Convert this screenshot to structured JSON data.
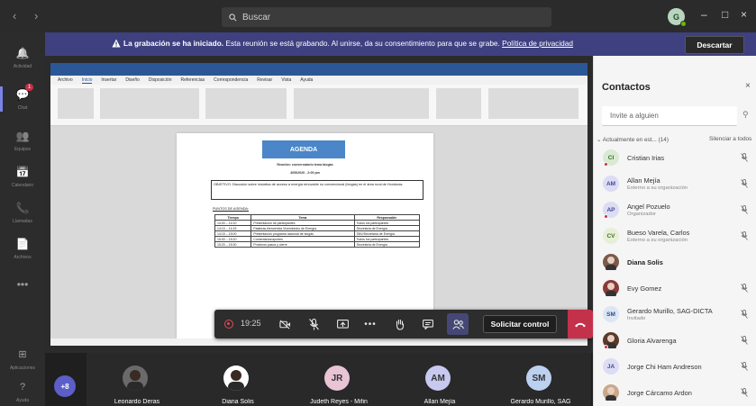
{
  "titlebar": {
    "nav": "‹ ›",
    "search_placeholder": "Buscar",
    "user_initials": "G",
    "min": "–",
    "max": "□",
    "close": "×"
  },
  "rail": {
    "items": [
      {
        "icon": "bell-icon",
        "glyph": "🔔",
        "label": "Actividad",
        "active": false
      },
      {
        "icon": "chat-icon",
        "glyph": "💬",
        "label": "Chat",
        "active": true,
        "badge": "1"
      },
      {
        "icon": "teams-icon",
        "glyph": "👥",
        "label": "Equipos",
        "active": false
      },
      {
        "icon": "calendar-icon",
        "glyph": "📅",
        "label": "Calendario",
        "active": false
      },
      {
        "icon": "phone-icon",
        "glyph": "📞",
        "label": "Llamadas",
        "active": false
      },
      {
        "icon": "files-icon",
        "glyph": "📄",
        "label": "Archivos",
        "active": false
      },
      {
        "icon": "more-icon",
        "glyph": "•••",
        "label": "",
        "active": false
      }
    ],
    "bottom": [
      {
        "icon": "apps-icon",
        "glyph": "⊞",
        "label": "Aplicaciones"
      },
      {
        "icon": "help-icon",
        "glyph": "?",
        "label": "Ayuda"
      }
    ]
  },
  "notice": {
    "bold": "La grabación se ha iniciado.",
    "text": " Esta reunión se está grabando. Al unirse, da su consentimiento para que se grabe. ",
    "link": "Política de privacidad",
    "dismiss": "Descartar"
  },
  "word": {
    "ribbon_tabs": [
      "Archivo",
      "Inicio",
      "Insertar",
      "Diseño",
      "Disposición",
      "Referencias",
      "Correspondencia",
      "Revisar",
      "Vista",
      "Ayuda"
    ],
    "document": {
      "title": "AGENDA",
      "subtitle": "Reunión: conversatorio tema biogás",
      "date": "4/05/2020   -   2:00 pm",
      "objective": "OBJETIVO: Discusión sobre iniciativa de acceso a energía renovable no convencional (biogás) en el área rural de Honduras.",
      "points_heading": "PUNTOS DE AGENDA:",
      "table_headers": [
        "Tiempo",
        "Tema",
        "Responsable"
      ],
      "table_rows": [
        [
          "14:00 – 14:10",
          "Presentación de participantes",
          "Todos los participantes"
        ],
        [
          "14:10 – 14:15",
          "Palabras bienvenida Viceministro de Energía",
          "Secretaría de Energía"
        ],
        [
          "14:15 – 15:00",
          "Presentación programa nacional de biogás",
          "SNV/Secretaría de Energía"
        ],
        [
          "15:00 – 15:20",
          "Comentarios/aportes",
          "Todos los participantes"
        ],
        [
          "15:20 – 15:30",
          "Próximos pasos y cierre",
          "Secretaría de Energía"
        ]
      ]
    }
  },
  "controls": {
    "timer": "19:25",
    "request_control": "Solicitar control"
  },
  "strip": {
    "overflow": "+8",
    "tiles": [
      {
        "initials": "",
        "name": "Leonardo Deras",
        "bg": "#6a6a6a",
        "photo": true
      },
      {
        "initials": "",
        "name": "Diana Solis",
        "bg": "#ffffff",
        "photo": true
      },
      {
        "initials": "JR",
        "name": "Judeth Reyes - Mifin",
        "bg": "#e8c4d4"
      },
      {
        "initials": "AM",
        "name": "Allan Mejía",
        "bg": "#c7c9f0"
      },
      {
        "initials": "SM",
        "name": "Gerardo Murillo, SAG",
        "bg": "#bcd0f0"
      }
    ]
  },
  "panel": {
    "title": "Contactos",
    "close": "×",
    "invite_placeholder": "Invite a alguien",
    "section": "⌄ Actualmente en est...  (14)",
    "silence_all": "Silenciar a todos",
    "people": [
      {
        "initials": "CI",
        "name": "Cristian Irias",
        "sub": "",
        "bg": "#d9ead3",
        "fg": "#3a6b2a",
        "status": "#c4314b"
      },
      {
        "initials": "AM",
        "name": "Allan Mejía",
        "sub": "Externo a su organización",
        "bg": "#dcdcf5",
        "fg": "#444791",
        "status": ""
      },
      {
        "initials": "AP",
        "name": "Angel Pozuelo",
        "sub": "Organizador",
        "bg": "#dcdcf5",
        "fg": "#444791",
        "status": "#c4314b"
      },
      {
        "initials": "CV",
        "name": "Bueso Varela, Carlos",
        "sub": "Externo a su organización",
        "bg": "#e6f0d8",
        "fg": "#4b6b22",
        "status": ""
      },
      {
        "initials": "DS",
        "name": "Diana Solis",
        "sub": "",
        "bg": "#7a5a4a",
        "fg": "#fff",
        "status": "",
        "bold": true,
        "photo": true
      },
      {
        "initials": "EG",
        "name": "Evy Gomez",
        "sub": "",
        "bg": "#8a3a3a",
        "fg": "#fff",
        "status": "",
        "photo": true
      },
      {
        "initials": "SM",
        "name": "Gerardo Murillo, SAG-DICTA",
        "sub": "Invitado",
        "bg": "#dce6f5",
        "fg": "#2a4d8a",
        "status": ""
      },
      {
        "initials": "GA",
        "name": "Gloria Alvarenga",
        "sub": "",
        "bg": "#5a3a2a",
        "fg": "#fff",
        "status": "#c4314b",
        "photo": true
      },
      {
        "initials": "JA",
        "name": "Jorge Chi Ham Andreson",
        "sub": "",
        "bg": "#dcdcf5",
        "fg": "#444791",
        "status": ""
      },
      {
        "initials": "JC",
        "name": "Jorge Cárcamo Ardon",
        "sub": "",
        "bg": "#c9a98a",
        "fg": "#fff",
        "status": "",
        "photo": true
      }
    ]
  },
  "colors": {
    "notice_bg": "#3e4080",
    "accent": "#7b83eb",
    "hangup": "#c4314b"
  }
}
